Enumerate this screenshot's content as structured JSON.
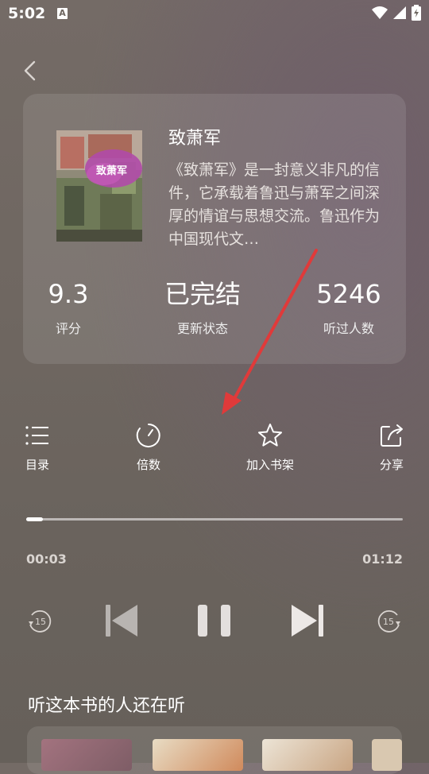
{
  "status_bar": {
    "time": "5:02",
    "a_icon": "A"
  },
  "book": {
    "title": "致萧军",
    "cover_title": "致萧军",
    "description": "《致萧军》是一封意义非凡的信件，它承载着鲁迅与萧军之间深厚的情谊与思想交流。鲁迅作为中国现代文…"
  },
  "stats": [
    {
      "value": "9.3",
      "label": "评分"
    },
    {
      "value": "已完结",
      "label": "更新状态"
    },
    {
      "value": "5246",
      "label": "听过人数"
    }
  ],
  "actions": [
    {
      "label": "目录",
      "icon": "list-icon"
    },
    {
      "label": "倍数",
      "icon": "speed-icon"
    },
    {
      "label": "加入书架",
      "icon": "star-icon"
    },
    {
      "label": "分享",
      "icon": "share-icon"
    }
  ],
  "player": {
    "current_time": "00:03",
    "total_time": "01:12",
    "progress": 0.045,
    "rewind_seconds": "15",
    "forward_seconds": "15"
  },
  "recommend": {
    "title": "听这本书的人还在听"
  },
  "colors": {
    "arrow": "#e03a3a",
    "background": "#6e6761"
  }
}
